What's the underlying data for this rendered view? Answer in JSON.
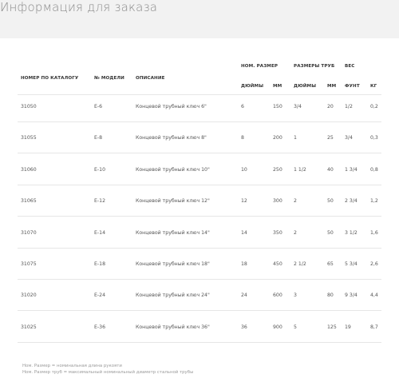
{
  "page": {
    "title": "Информация для заказа"
  },
  "table": {
    "headers": {
      "catalog_no": "НОМЕР ПО КАТАЛОГУ",
      "model_no": "№ МОДЕЛИ",
      "description": "ОПИСАНИЕ",
      "nom_size": "НОМ. РАЗМЕР",
      "pipe_sizes": "РАЗМЕРЫ ТРУБ",
      "weight": "ВЕС",
      "inches": "ДЮЙМЫ",
      "mm": "ММ",
      "pipe_inches": "ДЮЙМЫ",
      "pipe_mm": "ММ",
      "lb": "ФУНТ",
      "kg": "КГ"
    },
    "rows": [
      {
        "catalog": "31050",
        "model": "E-6",
        "desc": "Концевой трубный ключ 6\"",
        "in": "6",
        "mm": "150",
        "pin": "3/4",
        "pmm": "20",
        "lb": "1/2",
        "kg": "0,2"
      },
      {
        "catalog": "31055",
        "model": "E-8",
        "desc": "Концевой трубный ключ 8\"",
        "in": "8",
        "mm": "200",
        "pin": "1",
        "pmm": "25",
        "lb": "3/4",
        "kg": "0,3"
      },
      {
        "catalog": "31060",
        "model": "E-10",
        "desc": "Концевой трубный ключ 10\"",
        "in": "10",
        "mm": "250",
        "pin": "1 1/2",
        "pmm": "40",
        "lb": "1 3/4",
        "kg": "0,8"
      },
      {
        "catalog": "31065",
        "model": "E-12",
        "desc": "Концевой трубный ключ 12\"",
        "in": "12",
        "mm": "300",
        "pin": "2",
        "pmm": "50",
        "lb": "2 3/4",
        "kg": "1,2"
      },
      {
        "catalog": "31070",
        "model": "E-14",
        "desc": "Концевой трубный ключ 14\"",
        "in": "14",
        "mm": "350",
        "pin": "2",
        "pmm": "50",
        "lb": "3 1/2",
        "kg": "1,6"
      },
      {
        "catalog": "31075",
        "model": "E-18",
        "desc": "Концевой трубный ключ 18\"",
        "in": "18",
        "mm": "450",
        "pin": "2 1/2",
        "pmm": "65",
        "lb": "5 3/4",
        "kg": "2,6"
      },
      {
        "catalog": "31020",
        "model": "E-24",
        "desc": "Концевой трубный ключ 24\"",
        "in": "24",
        "mm": "600",
        "pin": "3",
        "pmm": "80",
        "lb": "9 3/4",
        "kg": "4,4"
      },
      {
        "catalog": "31025",
        "model": "E-36",
        "desc": "Концевой трубный ключ 36\"",
        "in": "36",
        "mm": "900",
        "pin": "5",
        "pmm": "125",
        "lb": "19",
        "kg": "8,7"
      }
    ]
  },
  "notes": {
    "line1": "Ном. Размер = номинальная длина рукояти",
    "line2": "Ном. Размер труб = максимальный номинальный диаметр стальной трубы"
  }
}
